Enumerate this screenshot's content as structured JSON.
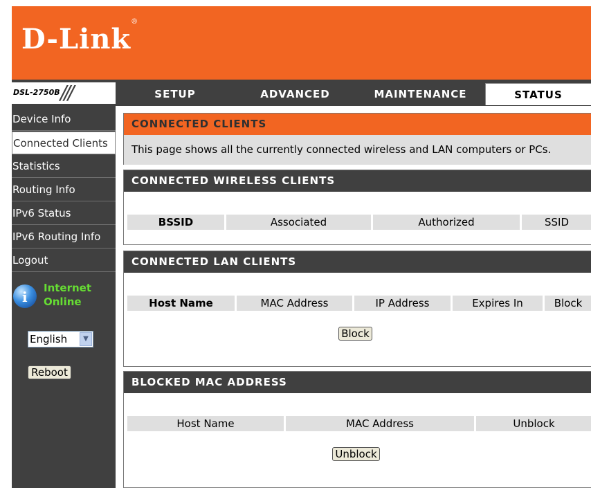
{
  "header": {
    "brand": "D-Link",
    "model": "DSL-2750B"
  },
  "nav": {
    "tabs": [
      "SETUP",
      "ADVANCED",
      "MAINTENANCE",
      "STATUS"
    ],
    "active_tab": "STATUS"
  },
  "sidebar": {
    "items": [
      "Device Info",
      "Connected Clients",
      "Statistics",
      "Routing Info",
      "IPv6 Status",
      "IPv6 Routing Info",
      "Logout"
    ],
    "active_item": "Connected Clients",
    "status_line1": "Internet",
    "status_line2": "Online",
    "language": "English",
    "reboot_label": "Reboot"
  },
  "connected_clients": {
    "title": "CONNECTED CLIENTS",
    "description": "This page shows all the currently connected wireless and LAN computers or PCs."
  },
  "wireless_clients": {
    "title": "CONNECTED WIRELESS CLIENTS",
    "columns": [
      "BSSID",
      "Associated",
      "Authorized",
      "SSID"
    ]
  },
  "lan_clients": {
    "title": "CONNECTED LAN CLIENTS",
    "columns": [
      "Host Name",
      "MAC Address",
      "IP Address",
      "Expires In",
      "Block"
    ],
    "block_button": "Block"
  },
  "blocked_mac": {
    "title": "BLOCKED MAC ADDRESS",
    "columns": [
      "Host Name",
      "MAC Address",
      "Unblock"
    ],
    "unblock_button": "Unblock"
  },
  "colors": {
    "brand_orange": "#f26522",
    "dark_gray": "#404040",
    "status_green": "#66dd33",
    "column_gray": "#dfdfdf"
  }
}
